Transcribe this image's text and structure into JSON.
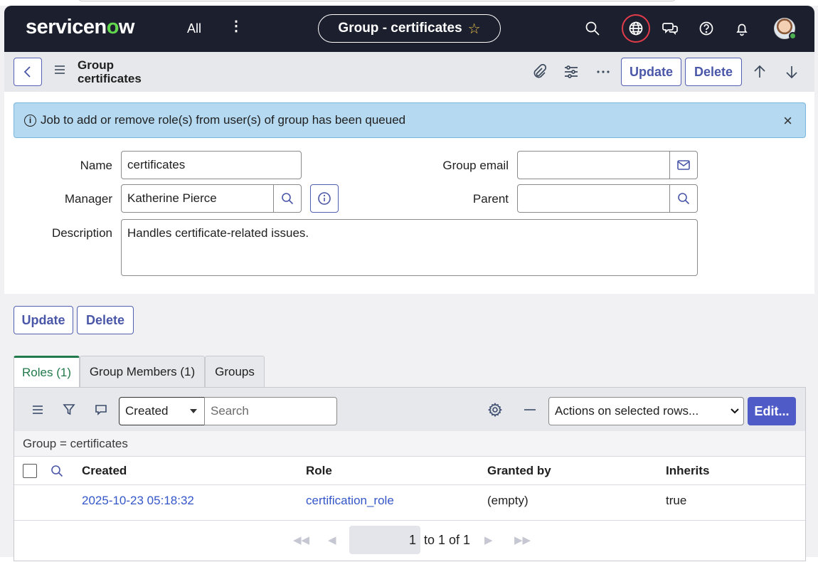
{
  "nav": {
    "logo_a": "servicen",
    "logo_o": "o",
    "logo_b": "w",
    "all": "All",
    "title": "Group - certificates",
    "star": "☆"
  },
  "header": {
    "title_line1": "Group",
    "title_line2": "certificates",
    "update": "Update",
    "delete": "Delete"
  },
  "alert": {
    "message": "Job to add or remove role(s) from user(s) of group has been queued",
    "info": "i",
    "close": "×"
  },
  "form": {
    "name_label": "Name",
    "name_value": "certificates",
    "manager_label": "Manager",
    "manager_value": "Katherine Pierce",
    "description_label": "Description",
    "description_value": "Handles certificate-related issues.",
    "group_email_label": "Group email",
    "group_email_value": "",
    "parent_label": "Parent",
    "parent_value": "",
    "info_glyph": "i"
  },
  "actions": {
    "update": "Update",
    "delete": "Delete"
  },
  "tabs": [
    {
      "label": "Roles (1)"
    },
    {
      "label": "Group Members (1)"
    },
    {
      "label": "Groups"
    }
  ],
  "list": {
    "sort_field": "Created",
    "search_placeholder": "Search",
    "actions_select": "Actions on selected rows...",
    "edit": "Edit...",
    "breadcrumb": "Group = certificates",
    "columns": [
      "Created",
      "Role",
      "Granted by",
      "Inherits"
    ],
    "rows": [
      {
        "created": "2025-10-23 05:18:32",
        "role": "certification_role",
        "granted_by": "(empty)",
        "inherits": "true"
      }
    ],
    "pager": {
      "current": "1",
      "range_text": "to 1 of 1"
    }
  },
  "colors": {
    "nav_bg": "#1c1f2d",
    "accent": "#4f5bc7",
    "tab_active": "#217a4b",
    "alert_bg": "#b5d9f1",
    "link": "#3456c9"
  }
}
